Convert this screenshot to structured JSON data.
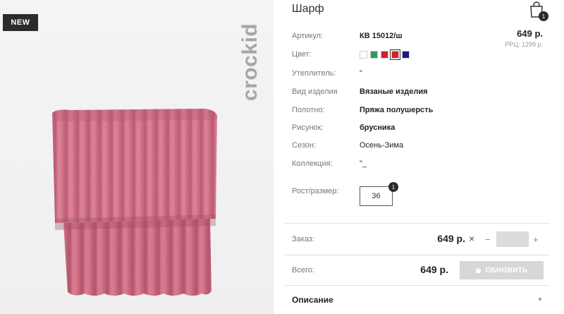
{
  "product": {
    "badge": "NEW",
    "brand": "crockid",
    "title": "Шарф",
    "cart_count": "1"
  },
  "details": [
    {
      "label": "Артикул:",
      "value": "КВ 15012/ш"
    },
    {
      "label": "Цвет:",
      "value": ""
    },
    {
      "label": "Утеплитель:",
      "value": "\""
    },
    {
      "label": "Вид изделия",
      "value": "Вязаные изделия"
    },
    {
      "label": "Полотно:",
      "value": "Пряжа полушерсть"
    },
    {
      "label": "Рисунок:",
      "value": "брусника"
    },
    {
      "label": "Сезон:",
      "value": "Осень-Зима"
    },
    {
      "label": "Коллекция:",
      "value": "\"_"
    }
  ],
  "price": {
    "main": "649 р.",
    "rrp": "РРЦ: 1299 р."
  },
  "colors": [
    "#ffffff",
    "#2e9a5a",
    "#d81f26",
    "#d81f26",
    "#1a1a8c"
  ],
  "size": {
    "label": "Рост/размер:",
    "value": "36",
    "count": "1"
  },
  "order": {
    "label": "Заказ:",
    "price": "649 р.",
    "times": "×",
    "minus": "−",
    "plus": "+",
    "qty_value": ""
  },
  "total": {
    "label": "Всего:",
    "price": "649 р.",
    "button_label": "ОБНОВИТЬ"
  },
  "description": {
    "label": "Описание"
  },
  "theme": {
    "accent_dark": "#2b2b2b",
    "button_disabled": "#d7d7d7"
  }
}
